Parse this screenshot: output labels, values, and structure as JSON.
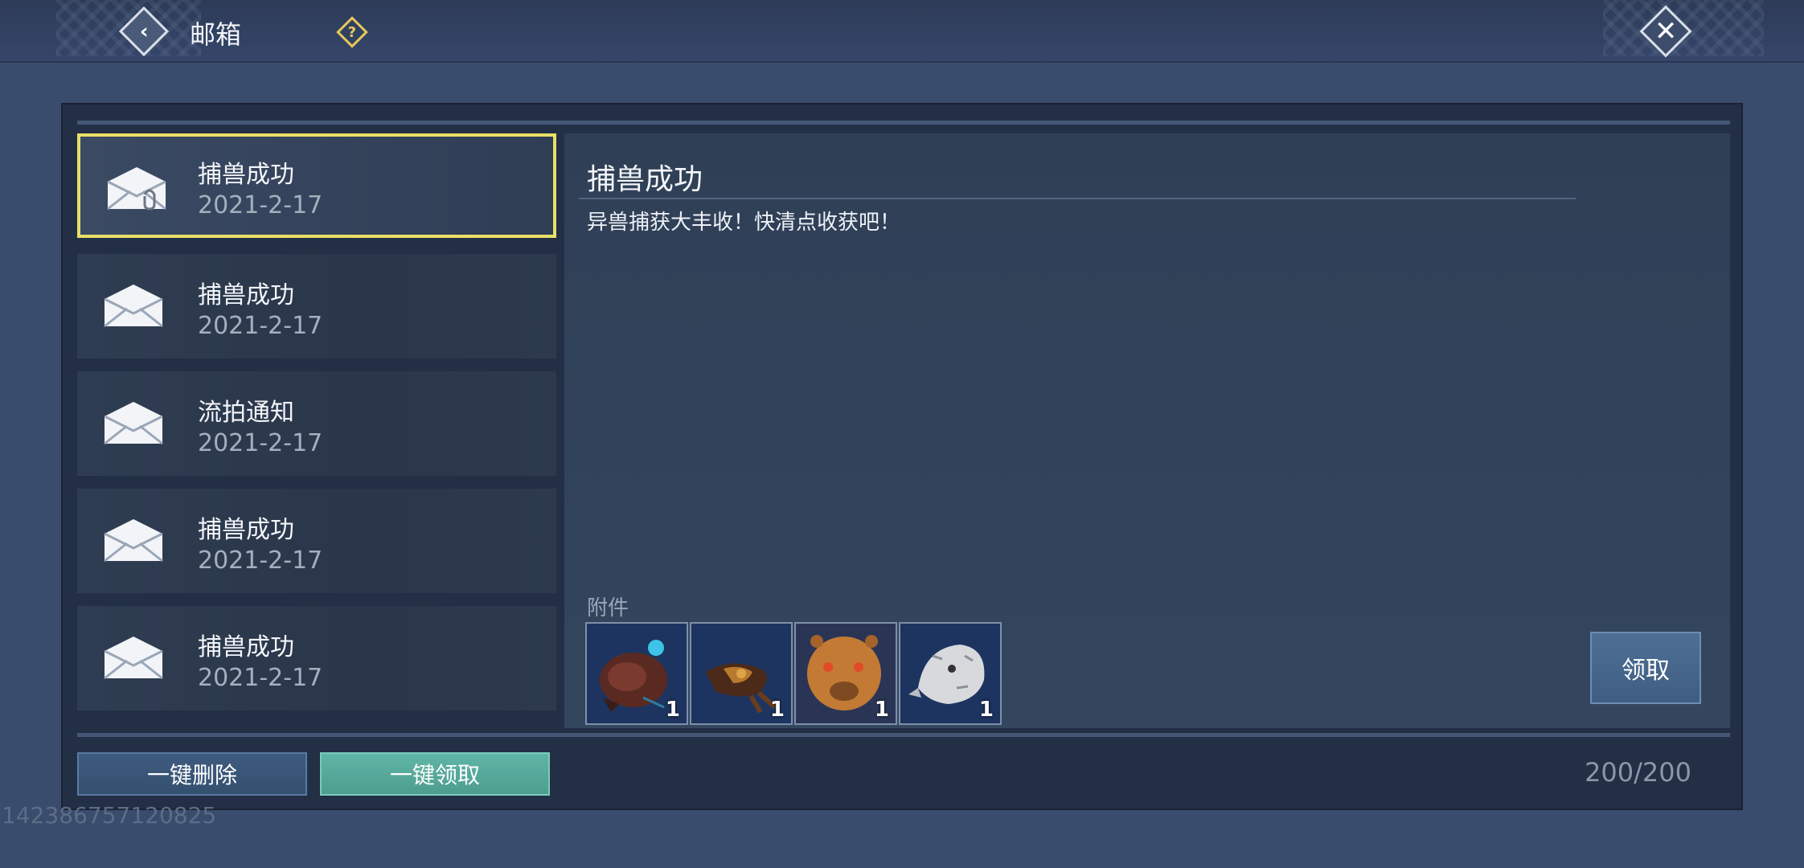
{
  "header": {
    "title": "邮箱",
    "back_icon": "back-arrow-icon",
    "help_symbol": "?",
    "close_icon": "close-x-icon"
  },
  "mail_list": [
    {
      "subject": "捕兽成功",
      "date": "2021-2-17",
      "selected": true
    },
    {
      "subject": "捕兽成功",
      "date": "2021-2-17",
      "selected": false
    },
    {
      "subject": "流拍通知",
      "date": "2021-2-17",
      "selected": false
    },
    {
      "subject": "捕兽成功",
      "date": "2021-2-17",
      "selected": false
    },
    {
      "subject": "捕兽成功",
      "date": "2021-2-17",
      "selected": false
    }
  ],
  "detail": {
    "title": "捕兽成功",
    "body": "异兽捕获大丰收！快清点收获吧！",
    "attachments_label": "附件",
    "attachments": [
      {
        "icon": "beast-head-dark-red-icon",
        "count": "1"
      },
      {
        "icon": "beast-claw-bronze-icon",
        "count": "1"
      },
      {
        "icon": "beast-head-orange-icon",
        "count": "1"
      },
      {
        "icon": "beast-head-white-icon",
        "count": "1"
      }
    ],
    "claim_label": "领取"
  },
  "footer": {
    "delete_all_label": "一键删除",
    "claim_all_label": "一键领取",
    "mail_count": "200/200"
  },
  "uid": "142386757120825",
  "colors": {
    "selected_border": "#e9df6a",
    "claim_all_bg": "#5fb6a6",
    "help_icon": "#e5c85a"
  }
}
